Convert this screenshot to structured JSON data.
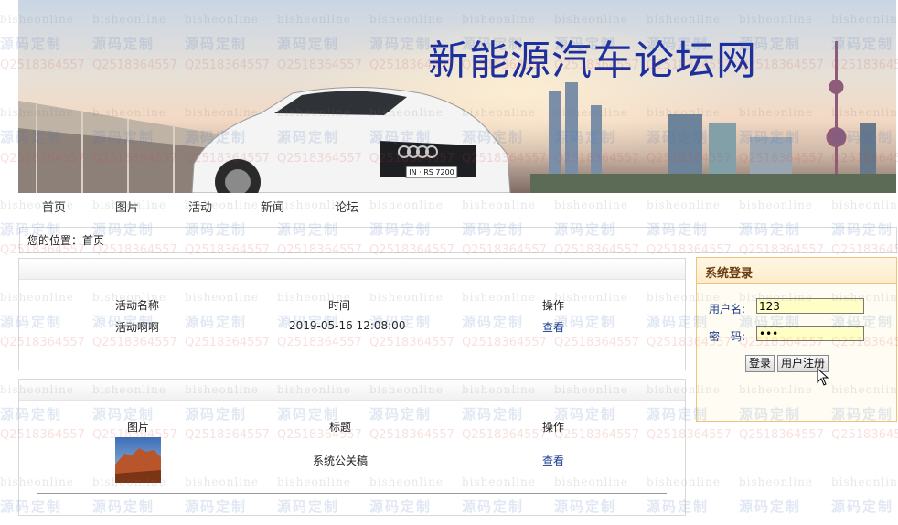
{
  "site": {
    "title": "新能源汽车论坛网",
    "plate": "IN · RS 7200"
  },
  "nav": {
    "items": [
      {
        "label": "首页"
      },
      {
        "label": "图片"
      },
      {
        "label": "活动"
      },
      {
        "label": "新闻"
      },
      {
        "label": "论坛"
      }
    ]
  },
  "breadcrumb": "您的位置：首页",
  "activities": {
    "headers": [
      "活动名称",
      "时间",
      "操作"
    ],
    "rows": [
      {
        "name": "活动啊啊",
        "time": "2019-05-16 12:08:00",
        "action": "查看"
      }
    ]
  },
  "images": {
    "headers": [
      "图片",
      "标题",
      "操作"
    ],
    "rows": [
      {
        "title": "系统公关稿",
        "action": "查看"
      }
    ]
  },
  "login": {
    "title": "系统登录",
    "username_label": "用户名:",
    "username_value": "123",
    "password_label": "密　码:",
    "password_value": "123",
    "login_button": "登录",
    "register_button": "用户注册"
  },
  "watermark": {
    "a": "bisheonline",
    "b": "源码定制",
    "c": "Q2518364557"
  },
  "colors": {
    "title": "#1c2f9e",
    "link": "#1a3e8c",
    "login_border": "#f0c27a",
    "input_bg": "#fffec4"
  }
}
